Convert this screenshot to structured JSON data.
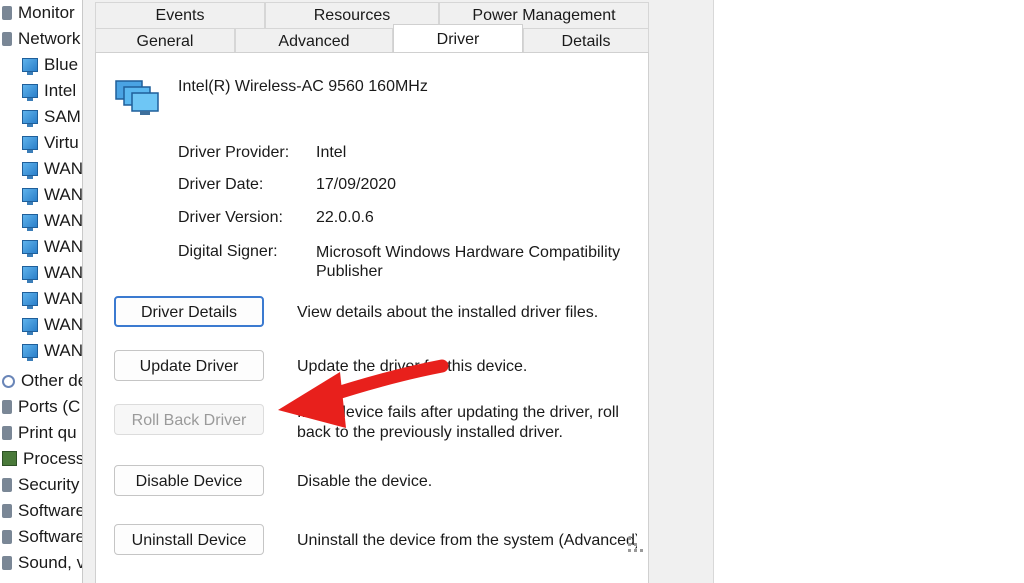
{
  "tree": {
    "items": [
      {
        "label": "Monitor",
        "icon": "monitor-icon"
      },
      {
        "label": "Network",
        "icon": "network-adapters-icon"
      },
      {
        "label": "Blue",
        "icon": "network-adapter-icon"
      },
      {
        "label": "Intel",
        "icon": "network-adapter-icon"
      },
      {
        "label": "SAM",
        "icon": "network-adapter-icon"
      },
      {
        "label": "Virtu",
        "icon": "network-adapter-icon"
      },
      {
        "label": "WAN",
        "icon": "network-adapter-icon"
      },
      {
        "label": "WAN",
        "icon": "network-adapter-icon"
      },
      {
        "label": "WAN",
        "icon": "network-adapter-icon"
      },
      {
        "label": "WAN",
        "icon": "network-adapter-icon"
      },
      {
        "label": "WAN",
        "icon": "network-adapter-icon"
      },
      {
        "label": "WAN",
        "icon": "network-adapter-icon"
      },
      {
        "label": "WAN",
        "icon": "network-adapter-icon"
      },
      {
        "label": "WAN",
        "icon": "network-adapter-icon"
      },
      {
        "label": "Other de",
        "icon": "other-devices-icon"
      },
      {
        "label": "Ports (C",
        "icon": "ports-icon"
      },
      {
        "label": "Print qu",
        "icon": "print-queue-icon"
      },
      {
        "label": "Process",
        "icon": "processor-icon"
      },
      {
        "label": "Security",
        "icon": "security-icon"
      },
      {
        "label": "Software",
        "icon": "software-icon"
      },
      {
        "label": "Software",
        "icon": "software-icon"
      },
      {
        "label": "Sound, v",
        "icon": "sound-icon"
      }
    ]
  },
  "dialog": {
    "tabs_top": [
      "Events",
      "Resources",
      "Power Management"
    ],
    "tabs_bottom": [
      "General",
      "Advanced",
      "Driver",
      "Details"
    ],
    "active_tab": "Driver",
    "device_name": "Intel(R) Wireless-AC 9560 160MHz",
    "properties": {
      "provider_label": "Driver Provider:",
      "provider_value": "Intel",
      "date_label": "Driver Date:",
      "date_value": "17/09/2020",
      "version_label": "Driver Version:",
      "version_value": "22.0.0.6",
      "signer_label": "Digital Signer:",
      "signer_value": "Microsoft Windows Hardware Compatibility Publisher"
    },
    "buttons": {
      "details_label": "Driver Details",
      "details_desc": "View details about the installed driver files.",
      "update_label": "Update Driver",
      "update_desc": "Update the driver for this device.",
      "rollback_label": "Roll Back Driver",
      "rollback_desc": "If the device fails after updating the driver, roll back to the previously installed driver.",
      "disable_label": "Disable Device",
      "disable_desc": "Disable the device.",
      "uninstall_label": "Uninstall Device",
      "uninstall_desc": "Uninstall the device from the system (Advanced)."
    }
  },
  "colors": {
    "annotation_arrow": "#e8201c",
    "focus_border": "#3b7ad0",
    "dialog_bg": "#f0f0f0"
  }
}
